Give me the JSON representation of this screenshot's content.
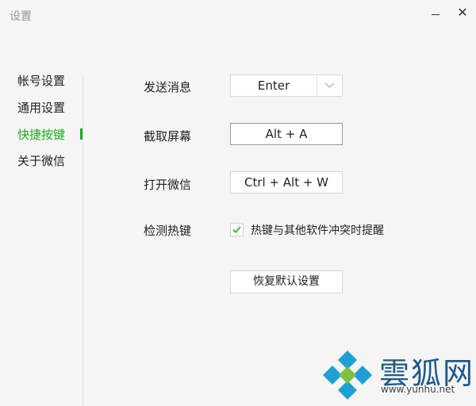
{
  "window": {
    "title": "设置",
    "minimize_icon": "minimize-icon",
    "close_glyph": "✕"
  },
  "sidebar": {
    "items": [
      {
        "label": "帐号设置",
        "active": false
      },
      {
        "label": "通用设置",
        "active": false
      },
      {
        "label": "快捷按键",
        "active": true
      },
      {
        "label": "关于微信",
        "active": false
      }
    ],
    "accent": "#1aad19"
  },
  "shortcuts": {
    "send": {
      "label": "发送消息",
      "value": "Enter"
    },
    "screenshot": {
      "label": "截取屏幕",
      "value": "Alt + A"
    },
    "open": {
      "label": "打开微信",
      "value": "Ctrl + Alt + W"
    },
    "detect": {
      "label": "检测热键",
      "checkbox_label": "热键与其他软件冲突时提醒",
      "checked": true
    }
  },
  "reset_button": "恢复默认设置",
  "watermark": {
    "text": "雲狐网",
    "url": "www.yunhu.net"
  }
}
